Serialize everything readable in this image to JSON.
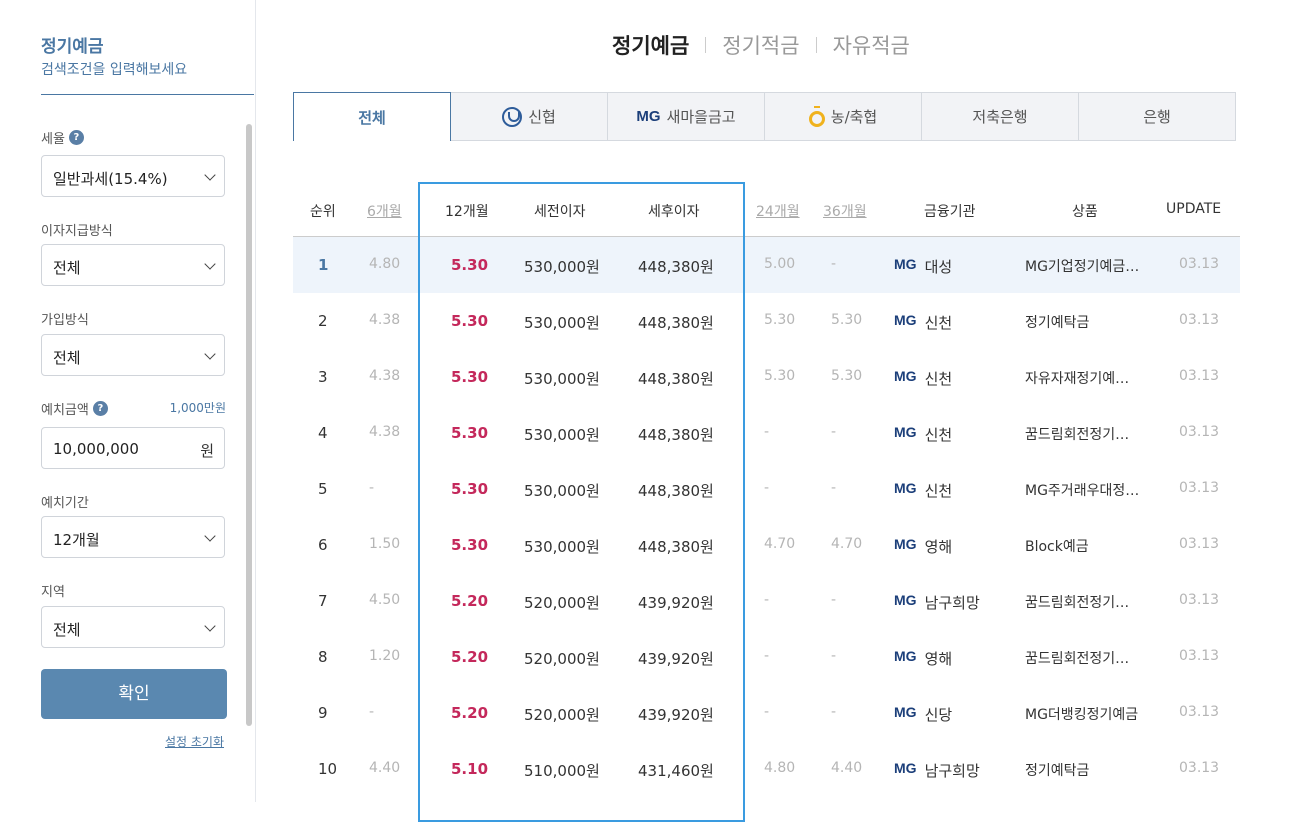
{
  "sidebar": {
    "title": "정기예금",
    "subtitle": "검색조건을 입력해보세요",
    "tax": {
      "label": "세율",
      "help": "?",
      "value": "일반과세(15.4%)"
    },
    "interest_method": {
      "label": "이자지급방식",
      "value": "전체"
    },
    "join_method": {
      "label": "가입방식",
      "value": "전체"
    },
    "amount": {
      "label": "예치금액",
      "help": "?",
      "hint": "1,000만원",
      "value": "10,000,000",
      "unit": "원"
    },
    "period": {
      "label": "예치기간",
      "value": "12개월"
    },
    "region": {
      "label": "지역",
      "value": "전체"
    },
    "confirm": "확인",
    "reset": "설정 초기화"
  },
  "top_tabs": [
    "정기예금",
    "정기적금",
    "자유적금"
  ],
  "cat_tabs": [
    "전체",
    "신협",
    "MG",
    "새마을금고",
    "농/축협",
    "저축은행",
    "은행"
  ],
  "table": {
    "headers": {
      "rank": "순위",
      "m6": "6개월",
      "m12": "12개월",
      "pre_tax": "세전이자",
      "post_tax": "세후이자",
      "m24": "24개월",
      "m36": "36개월",
      "institution": "금융기관",
      "product": "상품",
      "update": "UPDATE"
    },
    "rows": [
      {
        "rank": "1",
        "m6": "4.80",
        "m12": "5.30",
        "pre": "530,000원",
        "post": "448,380원",
        "m24": "5.00",
        "m36": "-",
        "brand": "MG",
        "inst": "대성",
        "prod": "MG기업정기예금…",
        "upd": "03.13"
      },
      {
        "rank": "2",
        "m6": "4.38",
        "m12": "5.30",
        "pre": "530,000원",
        "post": "448,380원",
        "m24": "5.30",
        "m36": "5.30",
        "brand": "MG",
        "inst": "신천",
        "prod": "정기예탁금",
        "upd": "03.13"
      },
      {
        "rank": "3",
        "m6": "4.38",
        "m12": "5.30",
        "pre": "530,000원",
        "post": "448,380원",
        "m24": "5.30",
        "m36": "5.30",
        "brand": "MG",
        "inst": "신천",
        "prod": "자유자재정기예…",
        "upd": "03.13"
      },
      {
        "rank": "4",
        "m6": "4.38",
        "m12": "5.30",
        "pre": "530,000원",
        "post": "448,380원",
        "m24": "-",
        "m36": "-",
        "brand": "MG",
        "inst": "신천",
        "prod": "꿈드림회전정기…",
        "upd": "03.13"
      },
      {
        "rank": "5",
        "m6": "-",
        "m12": "5.30",
        "pre": "530,000원",
        "post": "448,380원",
        "m24": "-",
        "m36": "-",
        "brand": "MG",
        "inst": "신천",
        "prod": "MG주거래우대정…",
        "upd": "03.13"
      },
      {
        "rank": "6",
        "m6": "1.50",
        "m12": "5.30",
        "pre": "530,000원",
        "post": "448,380원",
        "m24": "4.70",
        "m36": "4.70",
        "brand": "MG",
        "inst": "영해",
        "prod": "Block예금",
        "upd": "03.13"
      },
      {
        "rank": "7",
        "m6": "4.50",
        "m12": "5.20",
        "pre": "520,000원",
        "post": "439,920원",
        "m24": "-",
        "m36": "-",
        "brand": "MG",
        "inst": "남구희망",
        "prod": "꿈드림회전정기…",
        "upd": "03.13"
      },
      {
        "rank": "8",
        "m6": "1.20",
        "m12": "5.20",
        "pre": "520,000원",
        "post": "439,920원",
        "m24": "-",
        "m36": "-",
        "brand": "MG",
        "inst": "영해",
        "prod": "꿈드림회전정기…",
        "upd": "03.13"
      },
      {
        "rank": "9",
        "m6": "-",
        "m12": "5.20",
        "pre": "520,000원",
        "post": "439,920원",
        "m24": "-",
        "m36": "-",
        "brand": "MG",
        "inst": "신당",
        "prod": "MG더뱅킹정기예금",
        "upd": "03.13"
      },
      {
        "rank": "10",
        "m6": "4.40",
        "m12": "5.10",
        "pre": "510,000원",
        "post": "431,460원",
        "m24": "4.80",
        "m36": "4.40",
        "brand": "MG",
        "inst": "남구희망",
        "prod": "정기예탁금",
        "upd": "03.13"
      }
    ]
  }
}
